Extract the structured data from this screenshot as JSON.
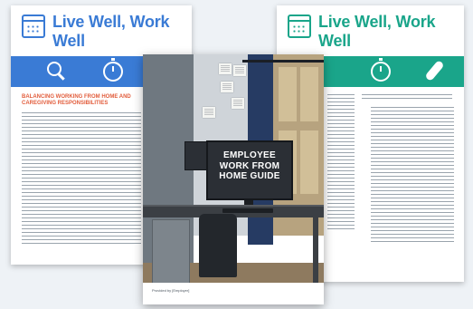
{
  "left_sheet": {
    "title": "Live Well, Work Well",
    "accent_color": "#3a7bd5",
    "band_icons": [
      "magnifier-icon",
      "stopwatch-icon"
    ],
    "heading": "BALANCING WORKING FROM HOME AND CAREGIVING RESPONSIBILITIES"
  },
  "right_sheet": {
    "title": "Live Well, Work Well",
    "accent_color": "#1aa58a",
    "band_icons": [
      "stopwatch-icon",
      "pill-icon"
    ]
  },
  "center_cover": {
    "title": "EMPLOYEE WORK FROM HOME GUIDE",
    "footer": "Provided by [Employer]"
  },
  "colors": {
    "background": "#eef2f6",
    "heading_orange": "#e25d3c",
    "curtain_navy": "#263b63"
  }
}
